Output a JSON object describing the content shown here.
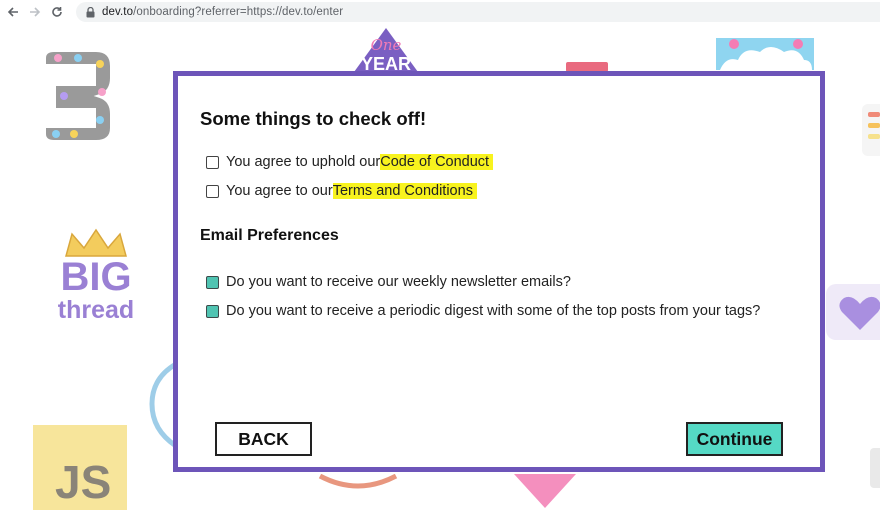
{
  "browser": {
    "url_host": "dev.to",
    "url_path": "/onboarding?referrer=https://dev.to/enter"
  },
  "stickers": {
    "big_line1": "BIG",
    "big_line2": "thread",
    "js": "JS",
    "one": "One",
    "year": "YEAR"
  },
  "dialog": {
    "title": "Some things to check off!",
    "checks": [
      {
        "prefix": "You agree to uphold our ",
        "link": "Code of Conduct",
        "checked": false
      },
      {
        "prefix": "You agree to our ",
        "link": "Terms and Conditions",
        "checked": false
      }
    ],
    "email_heading": "Email Preferences",
    "prefs": [
      {
        "label": "Do you want to receive our weekly newsletter emails?",
        "checked": true
      },
      {
        "label": "Do you want to receive a periodic digest with some of the top posts from your tags?",
        "checked": true
      }
    ],
    "back_label": "BACK",
    "continue_label": "Continue"
  },
  "colors": {
    "dialog_border": "#6d55b9",
    "checked_box": "#50c4b2",
    "continue_button": "#55d9c5",
    "highlight": "#f8f31e"
  }
}
